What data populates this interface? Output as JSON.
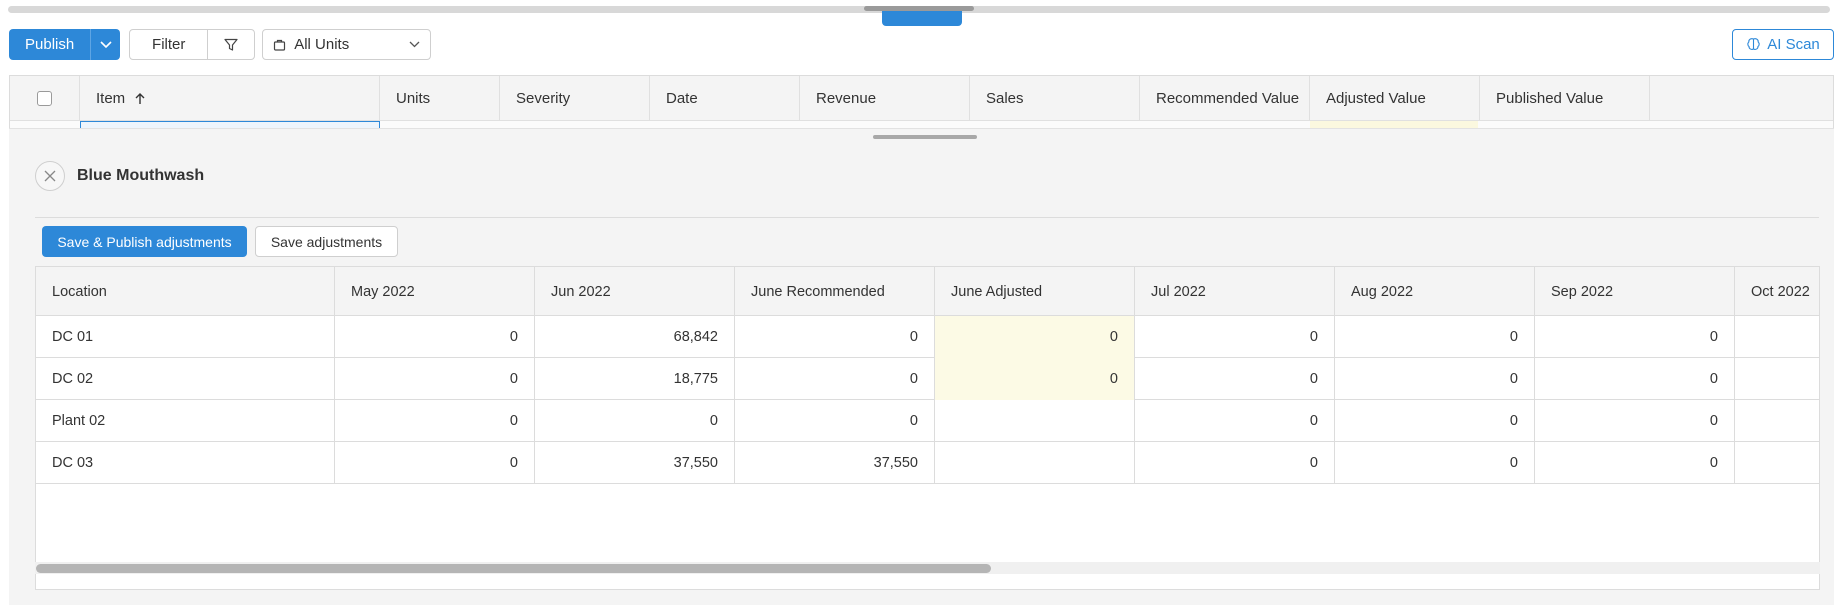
{
  "toolbar": {
    "publish_label": "Publish",
    "filter_label": "Filter",
    "units_value": "All Units",
    "ai_scan_label": "AI Scan"
  },
  "grid": {
    "columns": [
      "Item",
      "Units",
      "Severity",
      "Date",
      "Revenue",
      "Sales",
      "Recommended Value",
      "Adjusted Value",
      "Published Value"
    ]
  },
  "detail": {
    "title": "Blue Mouthwash",
    "save_publish_label": "Save & Publish adjustments",
    "save_label": "Save adjustments",
    "columns": [
      "Location",
      "May 2022",
      "Jun 2022",
      "June Recommended",
      "June Adjusted",
      "Jul 2022",
      "Aug 2022",
      "Sep 2022",
      "Oct 2022"
    ],
    "rows": [
      {
        "location": "DC 01",
        "may": "0",
        "jun": "68,842",
        "june_rec": "0",
        "june_adj": "0",
        "jul": "0",
        "aug": "0",
        "sep": "0"
      },
      {
        "location": "DC 02",
        "may": "0",
        "jun": "18,775",
        "june_rec": "0",
        "june_adj": "0",
        "jul": "0",
        "aug": "0",
        "sep": "0"
      },
      {
        "location": "Plant 02",
        "may": "0",
        "jun": "0",
        "june_rec": "0",
        "june_adj": "",
        "jul": "0",
        "aug": "0",
        "sep": "0"
      },
      {
        "location": "DC 03",
        "may": "0",
        "jun": "37,550",
        "june_rec": "37,550",
        "june_adj": "",
        "jul": "0",
        "aug": "0",
        "sep": "0"
      }
    ]
  },
  "colors": {
    "accent": "#2d88d8",
    "editable_cell": "#fcfae5"
  }
}
